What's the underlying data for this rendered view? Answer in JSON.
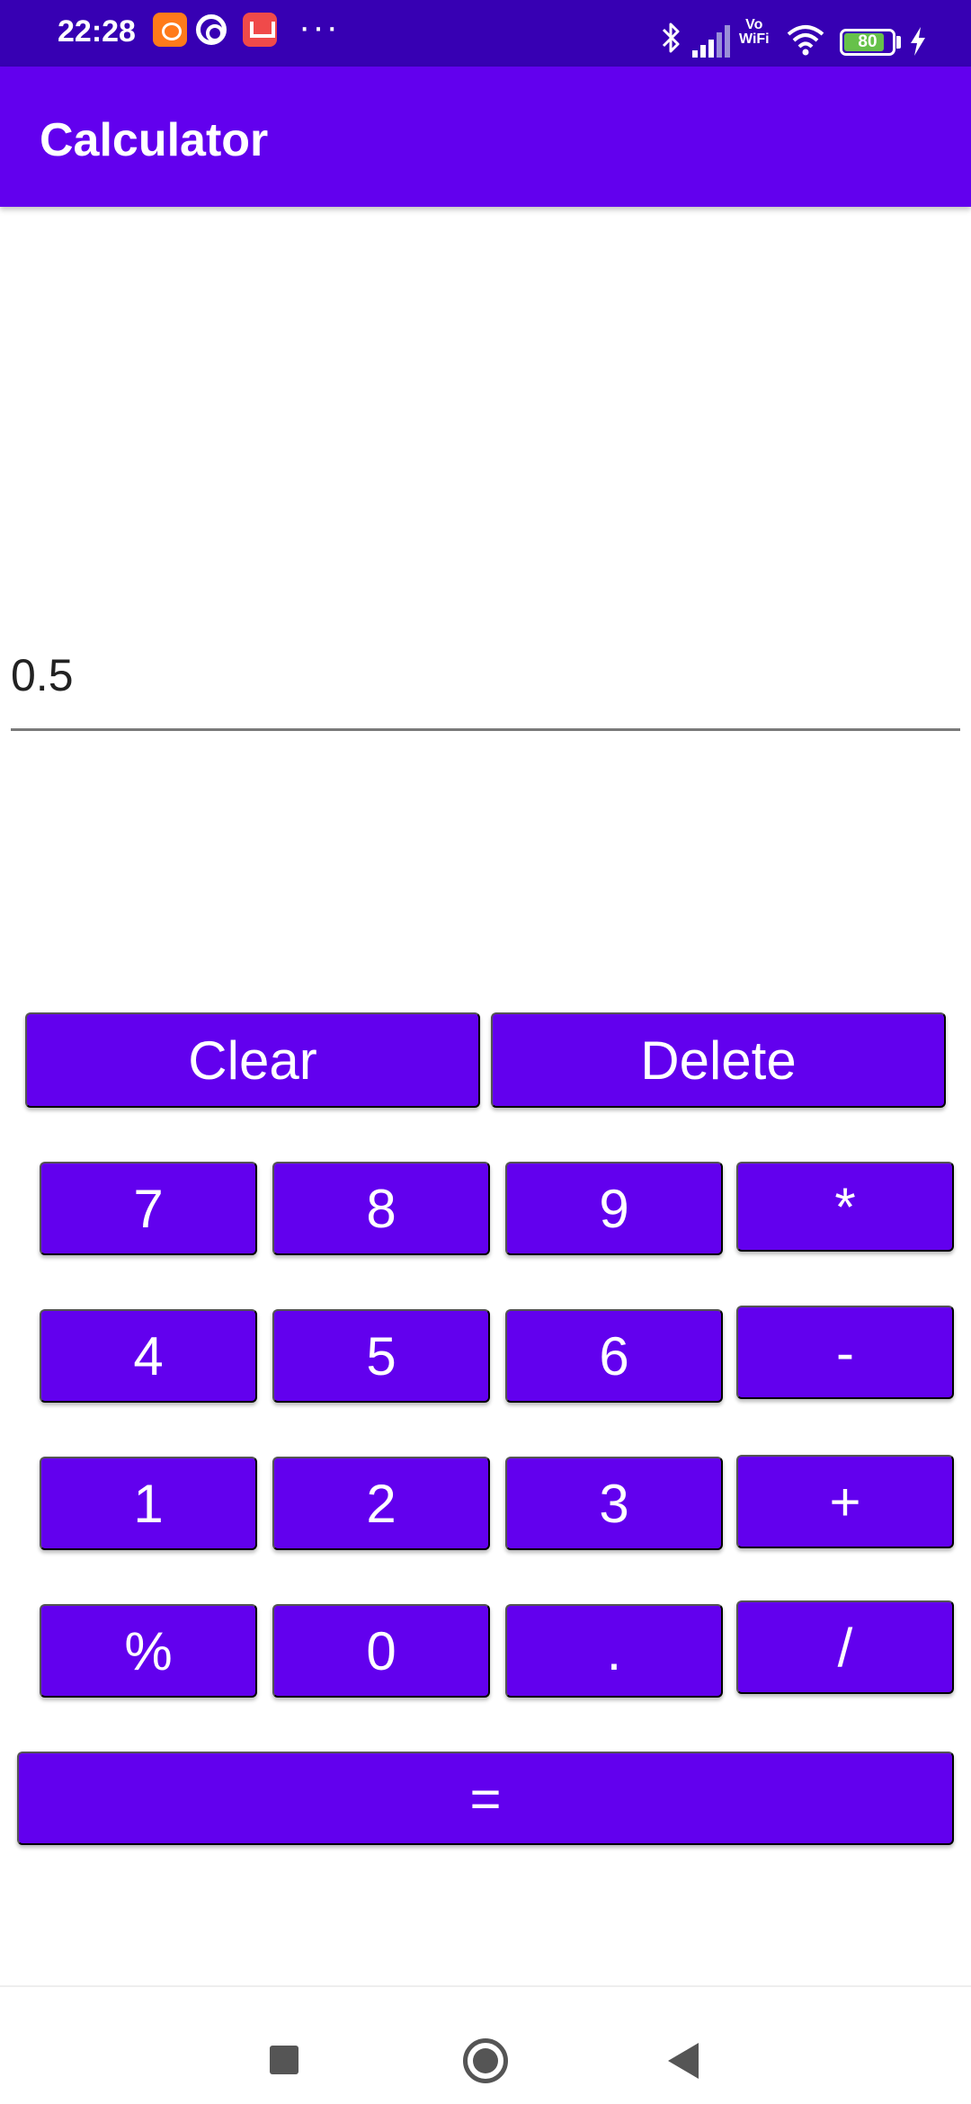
{
  "status_bar": {
    "time": "22:28",
    "battery_level": "80",
    "network_label_top": "Vo",
    "network_label_bottom": "WiFi",
    "more_glyph": "···",
    "icons": [
      "mi-app-icon",
      "at-sign-icon",
      "gift-app-icon",
      "bluetooth-icon",
      "signal-icon",
      "wifi-icon",
      "battery-icon",
      "charging-bolt-icon"
    ]
  },
  "app_bar": {
    "title": "Calculator"
  },
  "display": {
    "value": "0.5"
  },
  "controls": {
    "clear_label": "Clear",
    "delete_label": "Delete"
  },
  "keypad": {
    "row1": [
      "7",
      "8",
      "9",
      "*"
    ],
    "row2": [
      "4",
      "5",
      "6",
      "-"
    ],
    "row3": [
      "1",
      "2",
      "3",
      "+"
    ],
    "row4": [
      "%",
      "0",
      ".",
      "/"
    ],
    "equals_label": "="
  },
  "nav_bar": {
    "icons": [
      "recents-square-icon",
      "home-circle-icon",
      "back-triangle-icon"
    ]
  },
  "colors": {
    "status_bar": "#3700b3",
    "primary": "#6200ee",
    "battery_fill": "#66c14a"
  }
}
